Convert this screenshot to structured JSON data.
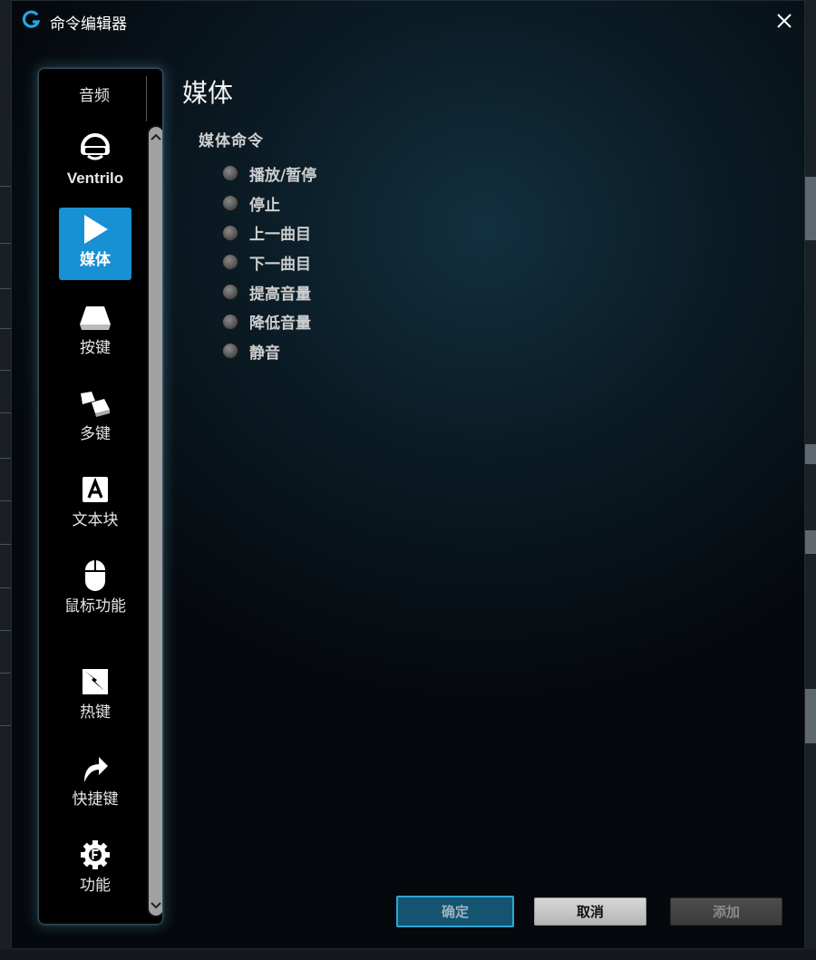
{
  "window": {
    "title": "命令编辑器",
    "logo_icon": "logitech-g-icon",
    "close_icon": "close-icon"
  },
  "sidebar": {
    "audio_label": "音频",
    "items": [
      {
        "label": "Ventrilo",
        "icon": "headset-icon"
      },
      {
        "label": "媒体",
        "icon": "play-icon",
        "active": true
      },
      {
        "label": "按键",
        "icon": "key-icon"
      },
      {
        "label": "多键",
        "icon": "multi-key-icon"
      },
      {
        "label": "文本块",
        "icon": "text-block-icon"
      },
      {
        "label": "鼠标功能",
        "icon": "mouse-icon"
      },
      {
        "label": "热键",
        "icon": "hotkey-icon"
      },
      {
        "label": "快捷键",
        "icon": "shortcut-arrow-icon"
      },
      {
        "label": "功能",
        "icon": "function-gear-icon"
      }
    ]
  },
  "panel": {
    "title": "媒体",
    "group_title": "媒体命令",
    "options": [
      "播放/暂停",
      "停止",
      "上一曲目",
      "下一曲目",
      "提高音量",
      "降低音量",
      "静音"
    ]
  },
  "footer": {
    "ok": "确定",
    "cancel": "取消",
    "add": "添加"
  },
  "colors": {
    "accent": "#1790d4",
    "ok_border": "#2fa5d6"
  }
}
